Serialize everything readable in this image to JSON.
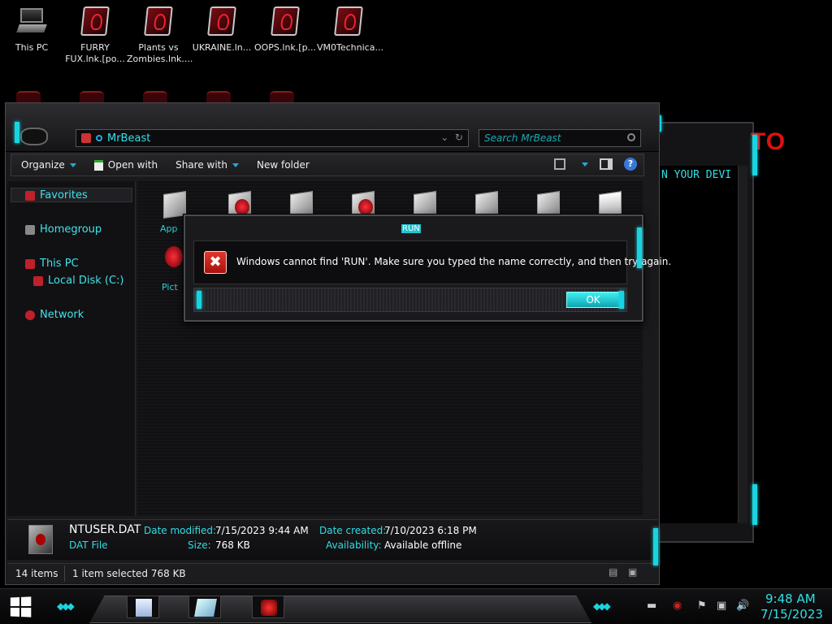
{
  "desktop": {
    "icons": [
      {
        "label": "This PC"
      },
      {
        "label": "FURRY FUX.lnk.[po..."
      },
      {
        "label": "Plants vs Zombies.lnk...."
      },
      {
        "label": "UKRAINE.ln..."
      },
      {
        "label": "OOPS.lnk.[p..."
      },
      {
        "label": "VM0Technica..."
      }
    ]
  },
  "background_window": {
    "text": "N YOUR DEVI",
    "red_text": "TO"
  },
  "explorer": {
    "address_path": "MrBeast",
    "search_placeholder": "Search MrBeast",
    "toolbar": {
      "organize": "Organize",
      "open_with": "Open with",
      "share_with": "Share with",
      "new_folder": "New folder",
      "help": "?"
    },
    "nav": {
      "favorites": "Favorites",
      "homegroup": "Homegroup",
      "this_pc": "This PC",
      "local_disk": "Local Disk (C:)",
      "network": "Network"
    },
    "content_labels": {
      "app": "App",
      "pict": "Pict"
    },
    "details": {
      "file_name": "NTUSER.DAT",
      "file_type": "DAT File",
      "date_modified_label": "Date modified:",
      "date_modified": "7/15/2023 9:44 AM",
      "size_label": "Size:",
      "size": "768 KB",
      "date_created_label": "Date created:",
      "date_created": "7/10/2023 6:18 PM",
      "availability_label": "Availability:",
      "availability": "Available offline"
    },
    "status": {
      "items": "14 items",
      "selection": "1 item selected  768 KB"
    }
  },
  "dialog": {
    "title": "RUN",
    "message": "Windows cannot find 'RUN'. Make sure you typed the name correctly, and then try again.",
    "ok_label": "OK"
  },
  "taskbar": {
    "time": "9:48 AM",
    "date": "7/15/2023"
  },
  "colors": {
    "accent": "#2fe0e6",
    "brand_red": "#e01010",
    "error_red": "#e4362b"
  }
}
